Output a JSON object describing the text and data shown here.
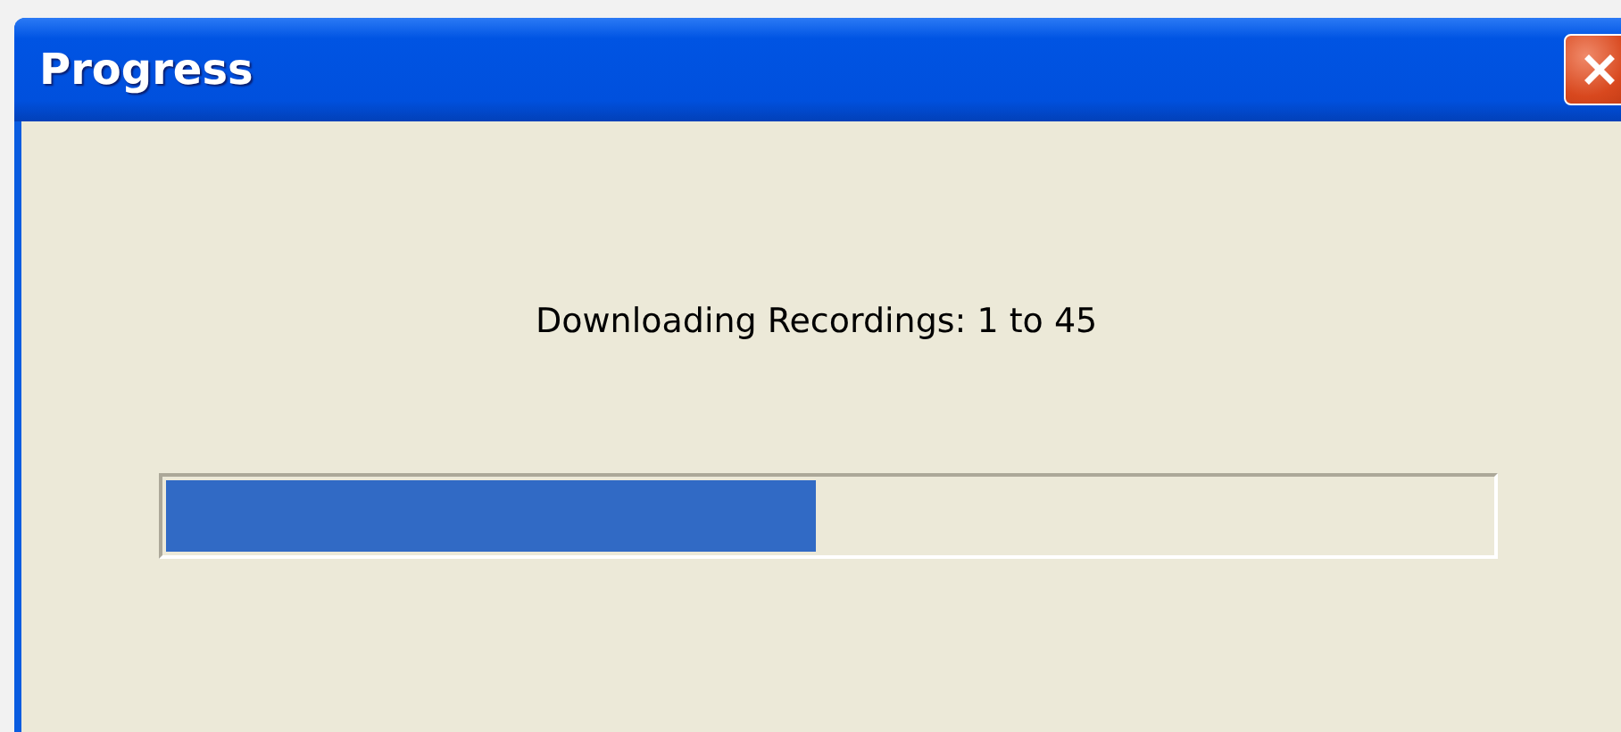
{
  "window": {
    "title": "Progress"
  },
  "message": "Downloading Recordings: 1 to 45",
  "progress": {
    "level": 0.49
  }
}
